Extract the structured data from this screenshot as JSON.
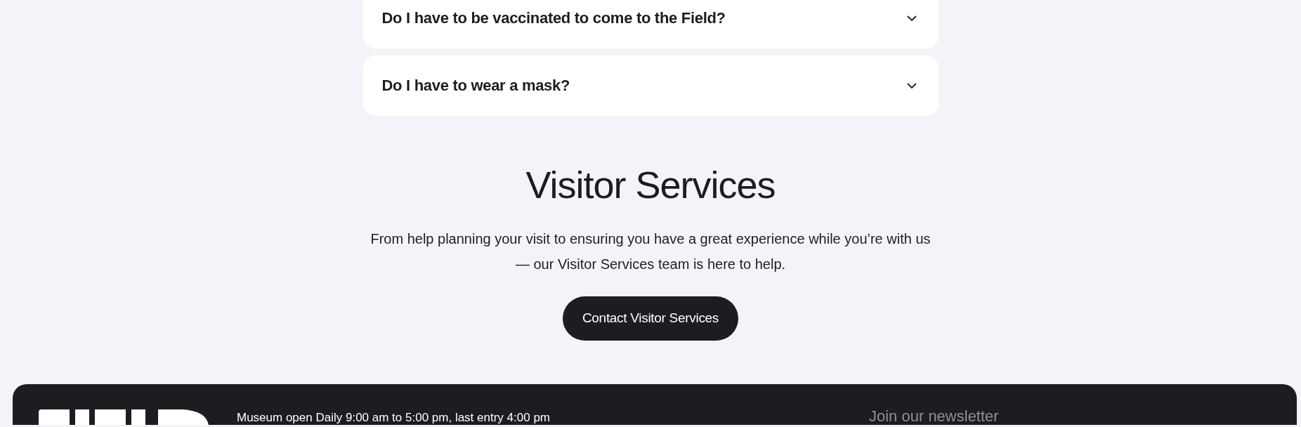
{
  "faq": [
    {
      "question": "Do I have to be vaccinated to come to the Field?",
      "expanded": false
    },
    {
      "question": "Do I have to wear a mask?",
      "expanded": false
    }
  ],
  "visitor_services": {
    "title": "Visitor Services",
    "text": "From help planning your visit to ensuring you have a great experience while you’re with us — our Visitor Services team is here to help.",
    "button": "Contact Visitor Services"
  },
  "footer": {
    "hours": "Museum open Daily 9:00 am to 5:00 pm, last entry 4:00 pm",
    "newsletter_title": "Join our newsletter"
  }
}
